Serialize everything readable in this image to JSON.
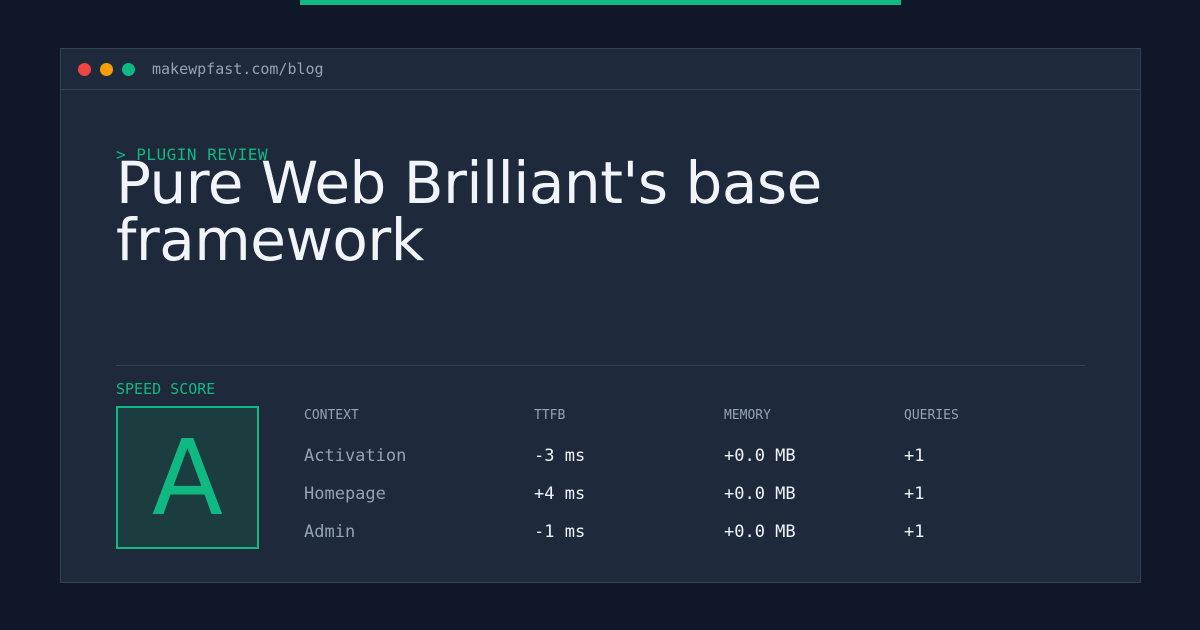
{
  "window": {
    "url": "makewpfast.com/blog",
    "dots": [
      "#ef4444",
      "#f59e0b",
      "#10b981"
    ]
  },
  "article": {
    "kicker": "> PLUGIN REVIEW",
    "title": "Pure Web Brilliant's base framework"
  },
  "score": {
    "label": "SPEED SCORE",
    "grade": "A"
  },
  "results": {
    "headers": [
      "CONTEXT",
      "TTFB",
      "MEMORY",
      "QUERIES"
    ],
    "rows": [
      {
        "context": "Activation",
        "ttfb": "-3 ms",
        "memory": "+0.0 MB",
        "queries": "+1"
      },
      {
        "context": "Homepage",
        "ttfb": "+4 ms",
        "memory": "+0.0 MB",
        "queries": "+1"
      },
      {
        "context": "Admin",
        "ttfb": "-1 ms",
        "memory": "+0.0 MB",
        "queries": "+1"
      }
    ]
  },
  "colors": {
    "accent": "#10b981",
    "background": "#0f1729",
    "panel": "#1e293b"
  }
}
